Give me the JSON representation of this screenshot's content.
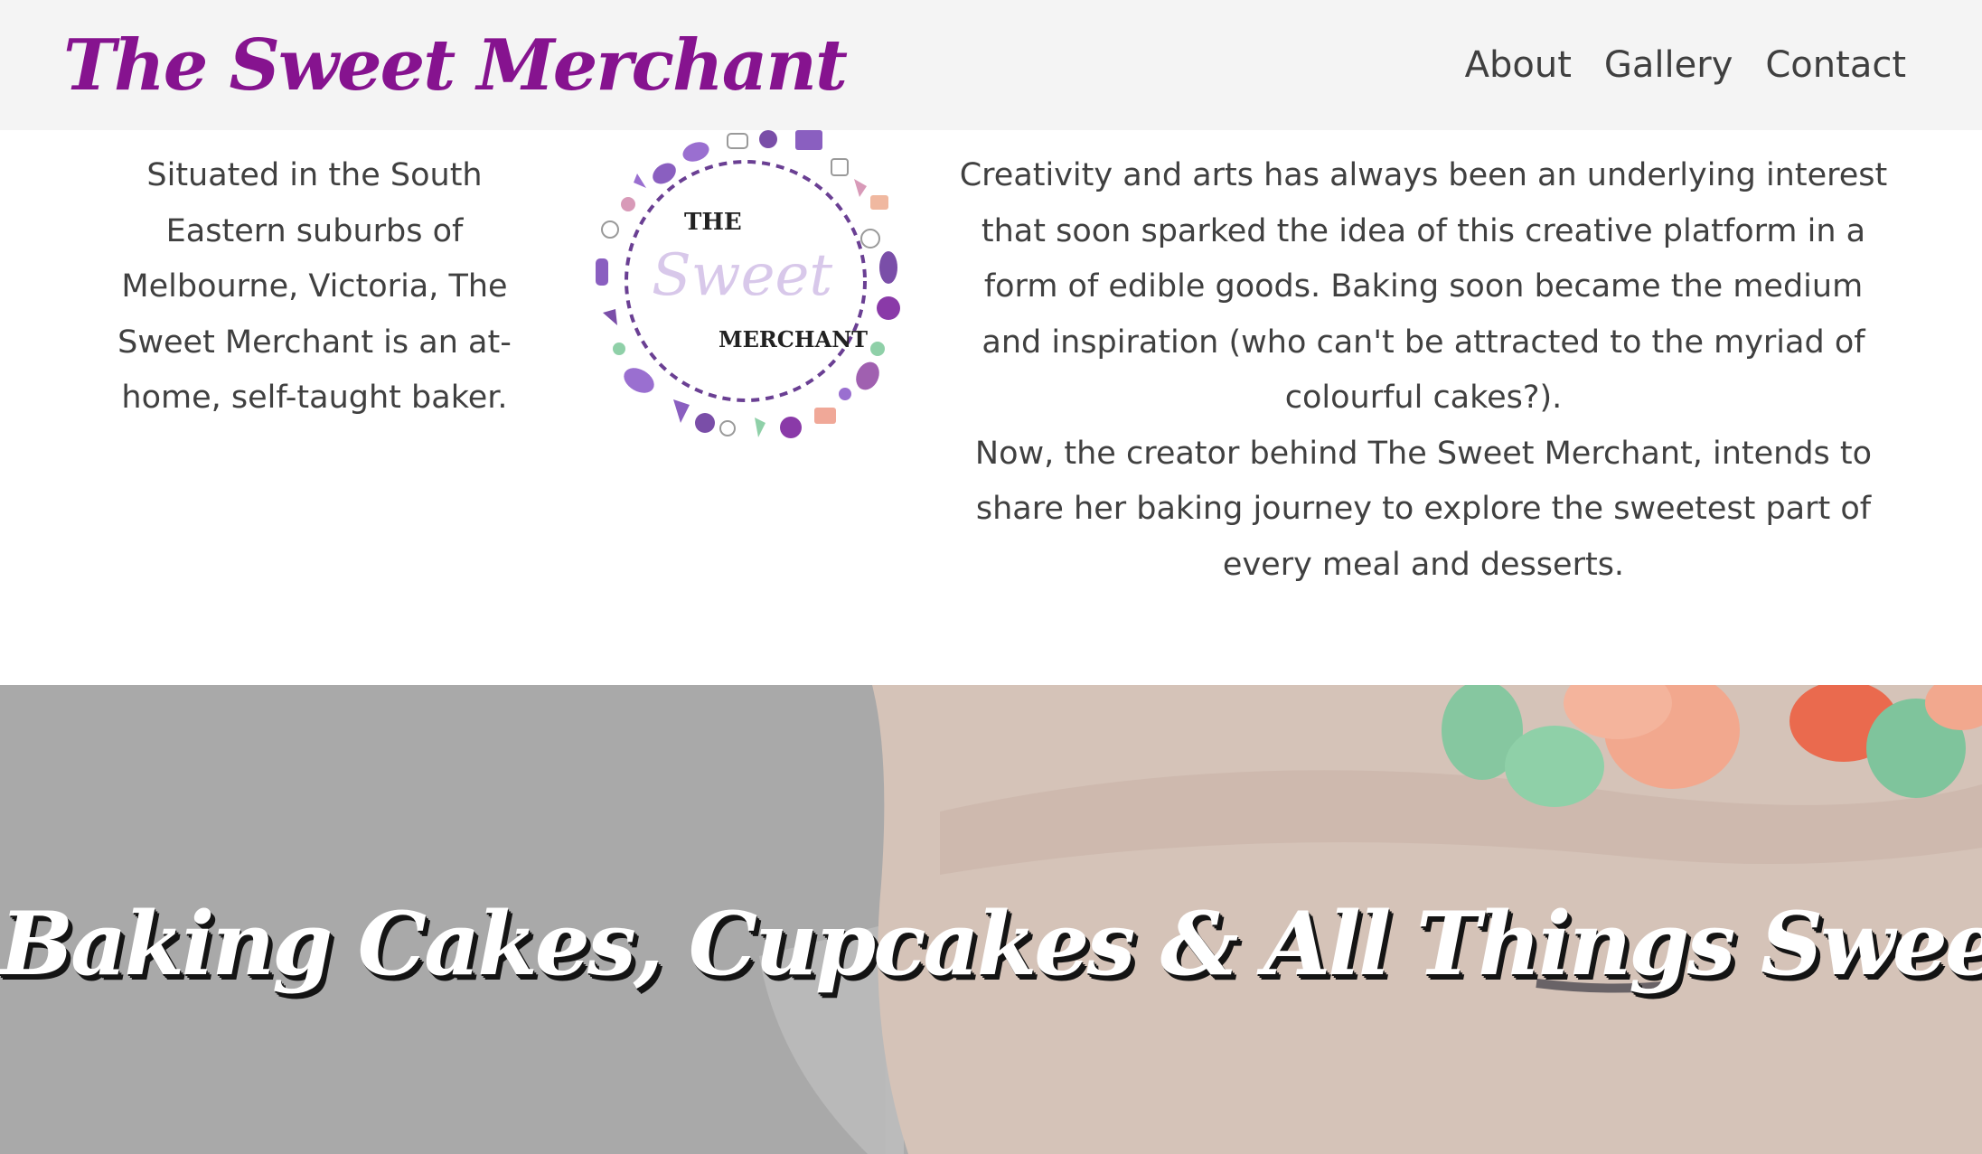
{
  "navbar": {
    "brand": "The Sweet Merchant",
    "links": [
      "About",
      "Gallery",
      "Contact"
    ]
  },
  "about": {
    "intro": "Situated in the South Eastern suburbs of Melbourne, Victoria, The Sweet Merchant is an at-home, self-taught baker.",
    "logo": {
      "line1": "THE",
      "line2": "Sweet",
      "line3": "MERCHANT"
    },
    "story": [
      "Creativity and arts has always been an underlying interest that soon sparked the idea of this creative platform in a form of edible goods. Baking soon became the medium and inspiration (who can't be attracted to the myriad of colourful cakes?).",
      "Now, the creator behind The Sweet Merchant, intends to share her baking journey to explore the sweetest part of every meal and desserts."
    ]
  },
  "hero": {
    "title": "Baking Cakes, Cupcakes & All Things Sweet"
  },
  "colors": {
    "brand": "#86138f",
    "navbar_bg": "#f4f4f4",
    "text": "#404040",
    "logo_purple": "#7a4ea8"
  }
}
